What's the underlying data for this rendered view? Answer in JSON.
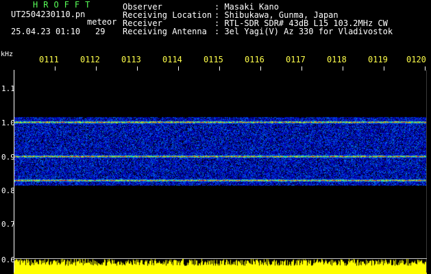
{
  "header": {
    "brand": "HROFFT",
    "filename": "UT2504230110.pn",
    "filename_suffix": "meteor",
    "datetime": "25.04.23 01:10",
    "count": "29",
    "fields": [
      {
        "label": "Observer",
        "value": ": Masaki Kano"
      },
      {
        "label": "Receiving Location",
        "value": ": Shibukawa, Gunma, Japan"
      },
      {
        "label": "Receiver",
        "value": ": RTL-SDR SDR# 43dB L15 103.2MHz CW"
      },
      {
        "label": "Receiving Antenna",
        "value": ": 3el Yagi(V) Az 330 for Vladivostok"
      }
    ]
  },
  "axis": {
    "unit": "kHz",
    "y_ticks": [
      "1.1",
      "1.0",
      "0.9",
      "0.8",
      "0.7",
      "0.6"
    ],
    "x_ticks": [
      "0111",
      "0112",
      "0113",
      "0114",
      "0115",
      "0116",
      "0117",
      "0118",
      "0119",
      "0120"
    ]
  },
  "spectrogram": {
    "freq_range_khz": [
      0.6,
      1.15
    ],
    "bands_khz": [
      1.0,
      0.9,
      0.83
    ]
  },
  "colors": {
    "text_green": "#58ff58",
    "text_white": "#ffffff",
    "text_yellow": "#ffff4a",
    "energy": "#ffff00"
  }
}
